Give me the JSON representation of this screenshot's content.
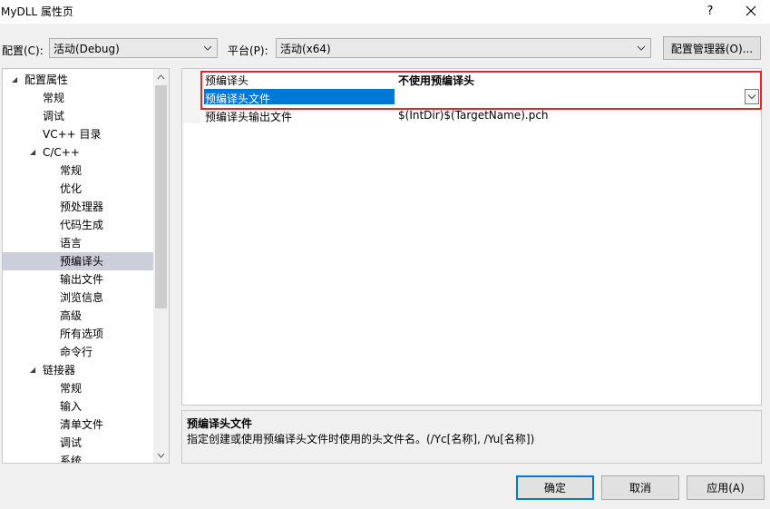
{
  "window": {
    "title": "MyDLL 属性页",
    "help_glyph": "?",
    "close_glyph": "✕"
  },
  "config_row": {
    "config_label": "配置(C):",
    "config_value": "活动(Debug)",
    "platform_label": "平台(P):",
    "platform_value": "活动(x64)",
    "manager_button": "配置管理器(O)..."
  },
  "tree": {
    "items": [
      {
        "label": "配置属性",
        "level": 0,
        "expanded": true
      },
      {
        "label": "常规",
        "level": 1
      },
      {
        "label": "调试",
        "level": 1
      },
      {
        "label": "VC++ 目录",
        "level": 1
      },
      {
        "label": "C/C++",
        "level": 1,
        "expanded": true
      },
      {
        "label": "常规",
        "level": 2
      },
      {
        "label": "优化",
        "level": 2
      },
      {
        "label": "预处理器",
        "level": 2
      },
      {
        "label": "代码生成",
        "level": 2
      },
      {
        "label": "语言",
        "level": 2
      },
      {
        "label": "预编译头",
        "level": 2,
        "selected": true
      },
      {
        "label": "输出文件",
        "level": 2
      },
      {
        "label": "浏览信息",
        "level": 2
      },
      {
        "label": "高级",
        "level": 2
      },
      {
        "label": "所有选项",
        "level": 2
      },
      {
        "label": "命令行",
        "level": 2
      },
      {
        "label": "链接器",
        "level": 1,
        "expanded": true
      },
      {
        "label": "常规",
        "level": 2
      },
      {
        "label": "输入",
        "level": 2
      },
      {
        "label": "清单文件",
        "level": 2
      },
      {
        "label": "调试",
        "level": 2
      },
      {
        "label": "系统",
        "level": 2
      }
    ],
    "expand_glyph": "◢",
    "scroll_up": "▲",
    "scroll_down": "▼"
  },
  "grid": {
    "rows": [
      {
        "name": "预编译头",
        "value": "不使用预编译头",
        "bold": true
      },
      {
        "name": "预编译头文件",
        "value": "",
        "selected": true
      },
      {
        "name": "预编译头输出文件",
        "value": "$(IntDir)$(TargetName).pch"
      }
    ]
  },
  "description": {
    "title": "预编译头文件",
    "text": "指定创建或使用预编译头文件时使用的头文件名。(/Yc[名称], /Yu[名称])"
  },
  "buttons": {
    "ok": "确定",
    "cancel": "取消",
    "apply": "应用(A)"
  },
  "colors": {
    "selection": "#0078d7",
    "tree_selection": "#cccedb",
    "highlight_box": "#e8232a"
  }
}
